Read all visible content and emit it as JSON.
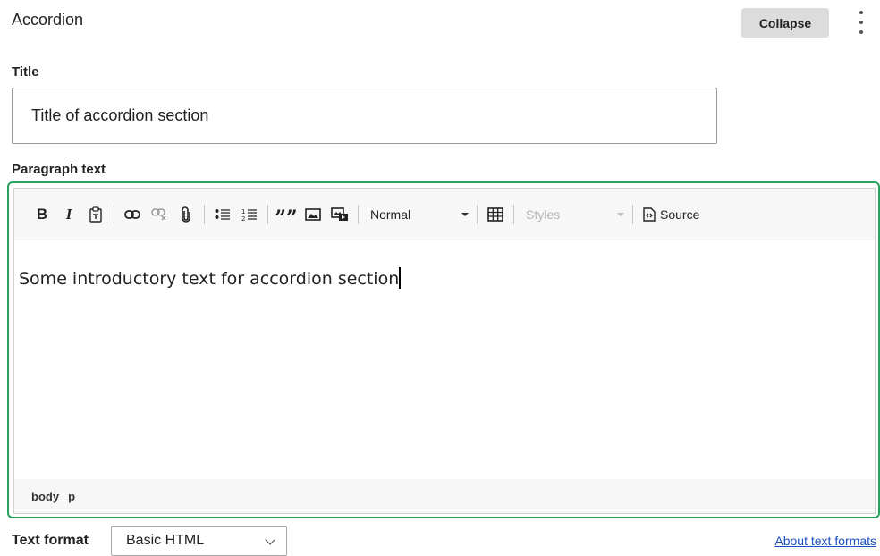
{
  "header": {
    "title": "Accordion",
    "collapse_label": "Collapse"
  },
  "title_field": {
    "label": "Title",
    "value": "Title of accordion section"
  },
  "paragraph": {
    "label": "Paragraph text",
    "toolbar": {
      "format_value": "Normal",
      "styles_value": "Styles",
      "source_label": "Source",
      "icons": [
        "bold-icon",
        "italic-icon",
        "paste-text-icon",
        "link-icon",
        "unlink-icon",
        "attachment-icon",
        "bulleted-list-icon",
        "numbered-list-icon",
        "blockquote-icon",
        "image-icon",
        "media-icon",
        "table-icon",
        "source-icon"
      ]
    },
    "content": "Some introductory text for accordion section",
    "path": [
      "body",
      "p"
    ]
  },
  "text_format": {
    "label": "Text format",
    "selected": "Basic HTML",
    "help_link": "About text formats"
  },
  "colors": {
    "focus_border": "#27a35c",
    "link": "#1a4fbf",
    "button_bg": "#dcdcdc"
  }
}
